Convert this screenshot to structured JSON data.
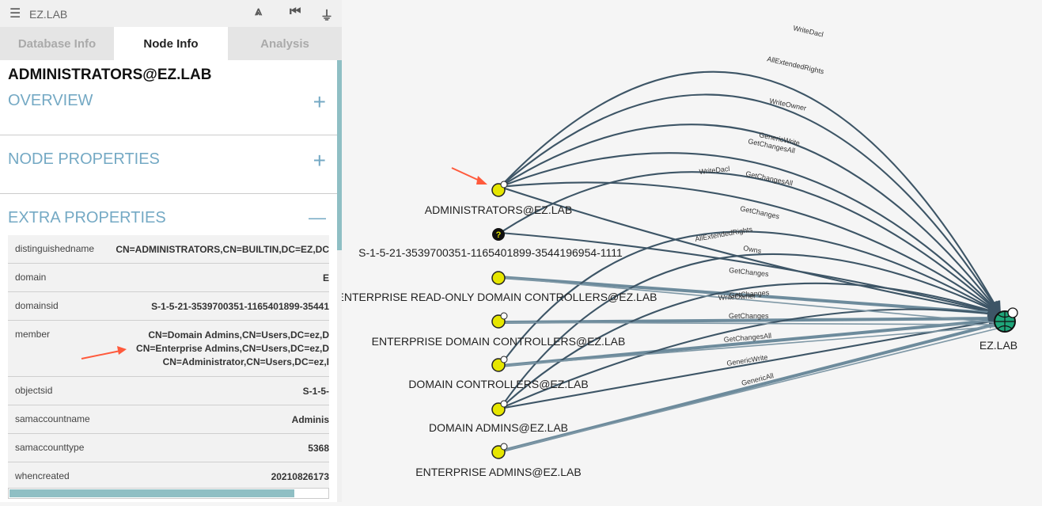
{
  "app": {
    "domain_name": "EZ.LAB",
    "menu_icon": "hamburger-icon",
    "toolbar_icons": [
      "pathfinding-icon",
      "back-icon",
      "filter-icon"
    ]
  },
  "tabs": [
    {
      "label": "Database Info",
      "active": false
    },
    {
      "label": "Node Info",
      "active": true
    },
    {
      "label": "Analysis",
      "active": false
    }
  ],
  "node": {
    "title": "ADMINISTRATORS@EZ.LAB",
    "sections": [
      {
        "label": "OVERVIEW",
        "sign": "+"
      },
      {
        "label": "NODE PROPERTIES",
        "sign": "+"
      },
      {
        "label": "EXTRA PROPERTIES",
        "sign": "—"
      }
    ]
  },
  "properties": [
    {
      "key": "distinguishedname",
      "value": [
        "CN=ADMINISTRATORS,CN=BUILTIN,DC=EZ,DC"
      ]
    },
    {
      "key": "domain",
      "value": [
        "E"
      ]
    },
    {
      "key": "domainsid",
      "value": [
        "S-1-5-21-3539700351-1165401899-35441"
      ]
    },
    {
      "key": "member",
      "value": [
        "CN=Domain Admins,CN=Users,DC=ez,D",
        "CN=Enterprise Admins,CN=Users,DC=ez,D",
        "CN=Administrator,CN=Users,DC=ez,I"
      ]
    },
    {
      "key": "objectsid",
      "value": [
        "S-1-5-"
      ]
    },
    {
      "key": "samaccountname",
      "value": [
        "Adminis"
      ]
    },
    {
      "key": "samaccounttype",
      "value": [
        "5368"
      ]
    },
    {
      "key": "whencreated",
      "value": [
        "20210826173"
      ]
    }
  ],
  "graph": {
    "nodes": [
      {
        "id": "administrators",
        "label": "ADMINISTRATORS@EZ.LAB",
        "type": "group"
      },
      {
        "id": "unknown-sid",
        "label": "S-1-5-21-3539700351-1165401899-3544196954-1111",
        "type": "unknown"
      },
      {
        "id": "erodc",
        "label": "ENTERPRISE READ-ONLY DOMAIN CONTROLLERS@EZ.LAB",
        "type": "group"
      },
      {
        "id": "edc",
        "label": "ENTERPRISE DOMAIN CONTROLLERS@EZ.LAB",
        "type": "group"
      },
      {
        "id": "dc",
        "label": "DOMAIN CONTROLLERS@EZ.LAB",
        "type": "group"
      },
      {
        "id": "da",
        "label": "DOMAIN ADMINS@EZ.LAB",
        "type": "group"
      },
      {
        "id": "ea",
        "label": "ENTERPRISE ADMINS@EZ.LAB",
        "type": "group"
      },
      {
        "id": "domain",
        "label": "EZ.LAB",
        "type": "domain"
      }
    ],
    "edge_labels": [
      "WriteDacl",
      "AllExtendedRights",
      "WriteOwner",
      "GenericWrite",
      "GetChangesAll",
      "WriteDacl",
      "GetChangesAll",
      "GetChanges",
      "AllExtendedRights",
      "Owns",
      "GetChanges",
      "WriteOwner",
      "GetChanges",
      "GetChanges",
      "GetChangesAll",
      "GenericWrite",
      "GenericAll"
    ]
  },
  "colors": {
    "accent": "#74a9c4",
    "edge": "#3d5566",
    "group_node": "#e6e600",
    "domain_node": "#1fa67a",
    "annotation_arrow": "#ff5a3c"
  }
}
